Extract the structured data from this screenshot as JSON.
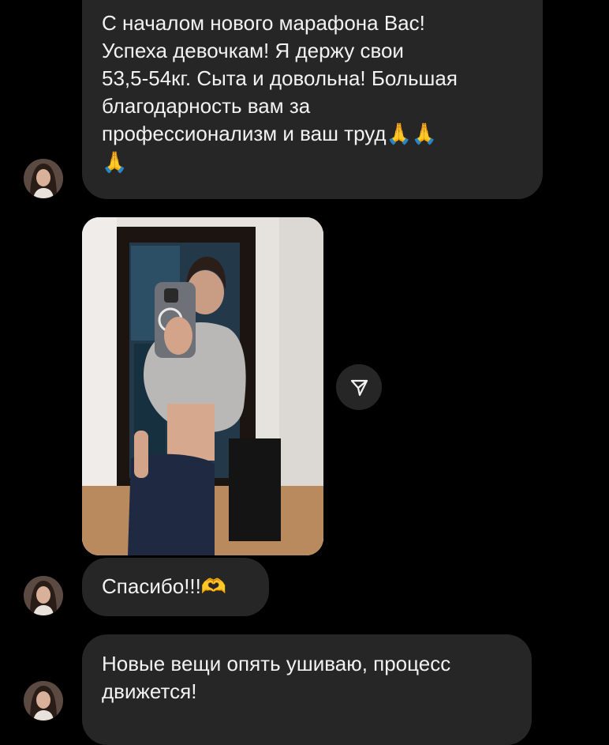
{
  "messages": [
    {
      "text_main": "С началом нового марафона Вас!\nУспеха девочкам! Я держу свои\n53,5-54кг. Сыта и довольна! Большая\nблагодарность вам за\nпрофессионализм и ваш труд",
      "emoji_inline": "🙏🙏",
      "emoji_last": "🙏"
    },
    {
      "text_main": "Спасибо!!!",
      "emoji_inline": "🫶"
    },
    {
      "text_main": "Новые вещи опять ушиваю, процесс\nдвижется!"
    }
  ],
  "photo": {
    "icon": "mirror-selfie-photo"
  },
  "share": {
    "icon": "send-icon"
  },
  "colors": {
    "background": "#000000",
    "bubble": "#262626",
    "text": "#f2f2f2"
  }
}
